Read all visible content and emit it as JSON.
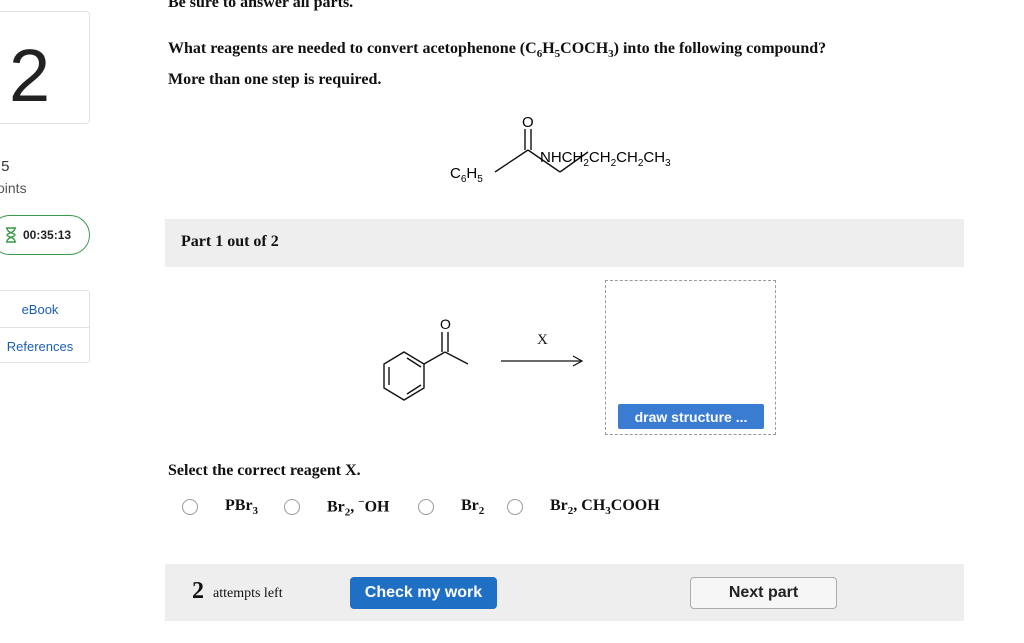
{
  "sidebar": {
    "question_number": "2",
    "points_value": ".5",
    "points_label": "oints",
    "timer": "00:35:13",
    "links": [
      "eBook",
      "References"
    ]
  },
  "question": {
    "top_cut": "Be sure to answer all parts.",
    "line1_before": "What reagents are needed to convert acetophenone (C",
    "line1_sub1": "6",
    "line1_mid": "H",
    "line1_sub2": "5",
    "line1_after": "COCH",
    "line1_sub3": "3",
    "line1_end": ") into the following compound?",
    "line2": "More than one step is required."
  },
  "target_molecule": {
    "carbonyl_o": "O",
    "phenyl_label": "C",
    "phenyl_sub1": "6",
    "phenyl_mid": "H",
    "phenyl_sub2": "5",
    "amine_label": "NHCH",
    "amine_sub": "2",
    "amine_mid1": "CH",
    "amine_mid2": "CH",
    "amine_end": "CH",
    "amine_end_sub": "3"
  },
  "part": {
    "label": "Part 1 out of 2"
  },
  "reaction": {
    "reactant_o": "O",
    "reagent_symbol": "X",
    "draw_button": "draw structure ..."
  },
  "select": {
    "prompt": "Select the correct reagent X.",
    "options": [
      {
        "a": "PBr",
        "sub": "3"
      },
      {
        "a": "Br",
        "sub": "2",
        "b": ", ",
        "sup": "−",
        "c": "OH"
      },
      {
        "a": "Br",
        "sub": "2"
      },
      {
        "a": "Br",
        "sub": "2",
        "b": ", CH",
        "sub2": "3",
        "c": "COOH"
      }
    ]
  },
  "footer": {
    "attempts_count": "2",
    "attempts_label": "attempts left",
    "check_button": "Check my work",
    "next_button": "Next part"
  },
  "colors": {
    "primary_blue": "#1f6fc5",
    "draw_blue": "#3a7cd1",
    "timer_green": "#3a9b4a",
    "band_gray": "#eeeeee",
    "link_blue": "#1a5fb4"
  }
}
